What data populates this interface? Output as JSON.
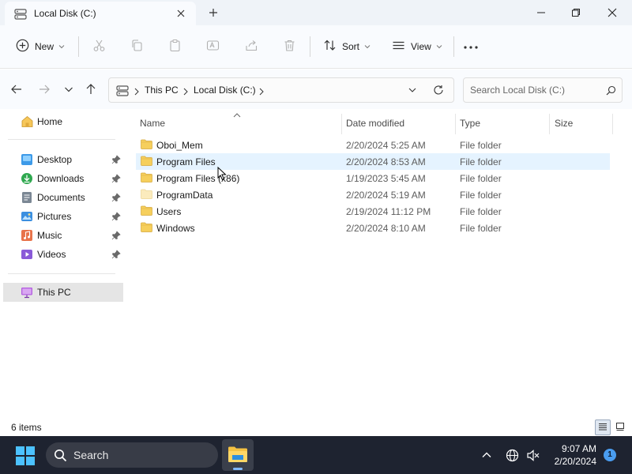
{
  "window": {
    "tab_title": "Local Disk (C:)",
    "tab_icon": "drive-icon"
  },
  "toolbar": {
    "new_label": "New",
    "sort_label": "Sort",
    "view_label": "View"
  },
  "address": {
    "segments": [
      "This PC",
      "Local Disk (C:)"
    ]
  },
  "search": {
    "placeholder": "Search Local Disk (C:)"
  },
  "sidebar": {
    "items": [
      {
        "label": "Home",
        "icon": "home-icon",
        "pinned": false
      },
      {
        "label": "Desktop",
        "icon": "desktop-icon",
        "pinned": true
      },
      {
        "label": "Downloads",
        "icon": "downloads-icon",
        "pinned": true
      },
      {
        "label": "Documents",
        "icon": "documents-icon",
        "pinned": true
      },
      {
        "label": "Pictures",
        "icon": "pictures-icon",
        "pinned": true
      },
      {
        "label": "Music",
        "icon": "music-icon",
        "pinned": true
      },
      {
        "label": "Videos",
        "icon": "videos-icon",
        "pinned": true
      },
      {
        "label": "This PC",
        "icon": "this-pc-icon",
        "pinned": false,
        "selected": true
      }
    ]
  },
  "columns": {
    "name": "Name",
    "date": "Date modified",
    "type": "Type",
    "size": "Size"
  },
  "files": [
    {
      "name": "Oboi_Mem",
      "date": "2/20/2024 5:25 AM",
      "type": "File folder"
    },
    {
      "name": "Program Files",
      "date": "2/20/2024 8:53 AM",
      "type": "File folder"
    },
    {
      "name": "Program Files (x86)",
      "date": "1/19/2023 5:45 AM",
      "type": "File folder"
    },
    {
      "name": "ProgramData",
      "date": "2/20/2024 5:19 AM",
      "type": "File folder"
    },
    {
      "name": "Users",
      "date": "2/19/2024 11:12 PM",
      "type": "File folder"
    },
    {
      "name": "Windows",
      "date": "2/20/2024 8:10 AM",
      "type": "File folder"
    }
  ],
  "status": {
    "item_count": "6 items"
  },
  "taskbar": {
    "search_label": "Search",
    "time": "9:07 AM",
    "date": "2/20/2024",
    "notification_count": "1"
  },
  "colors": {
    "folder": "#f4c542",
    "accent": "#0067c0",
    "hover_row": "#e5f3ff",
    "taskbar": "#1e2330"
  }
}
